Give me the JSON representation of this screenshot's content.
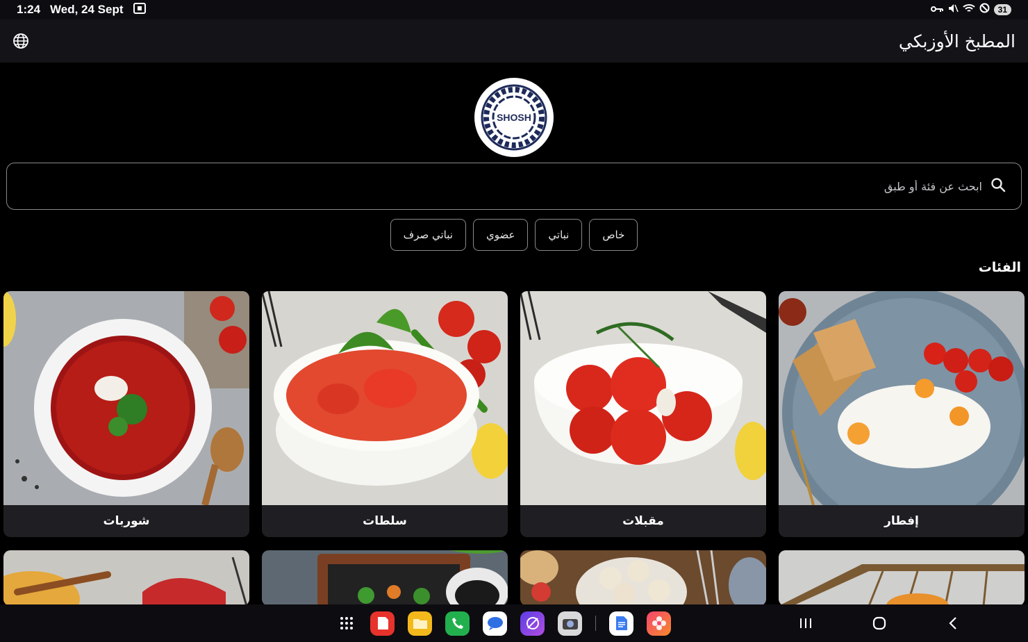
{
  "status_bar": {
    "time": "1:24",
    "date": "Wed, 24 Sept",
    "battery": "31"
  },
  "app_bar": {
    "title": "المطبخ الأوزبكي",
    "icon": "globe-icon"
  },
  "logo": {
    "text": "SHOSH"
  },
  "search": {
    "placeholder": "ابحث عن فئة أو طبق",
    "icon": "search-icon"
  },
  "filters": [
    "خاص",
    "نباتي",
    "عضوي",
    "نباتي صرف"
  ],
  "section_title": "الفئات",
  "categories": [
    {
      "label": "إفطار"
    },
    {
      "label": "مقبلات"
    },
    {
      "label": "سلطات"
    },
    {
      "label": "شوربات"
    }
  ],
  "colors": {
    "background": "#000000",
    "app_bar": "#141318",
    "card": "#1f1e22",
    "logo_navy": "#1e2a5a"
  },
  "nav": {
    "apps": [
      "apps-grid-icon",
      "notes-app-icon",
      "files-app-icon",
      "phone-app-icon",
      "messages-app-icon",
      "browser-app-icon",
      "camera-app-icon",
      "docs-app-icon",
      "gallery-app-icon"
    ]
  }
}
